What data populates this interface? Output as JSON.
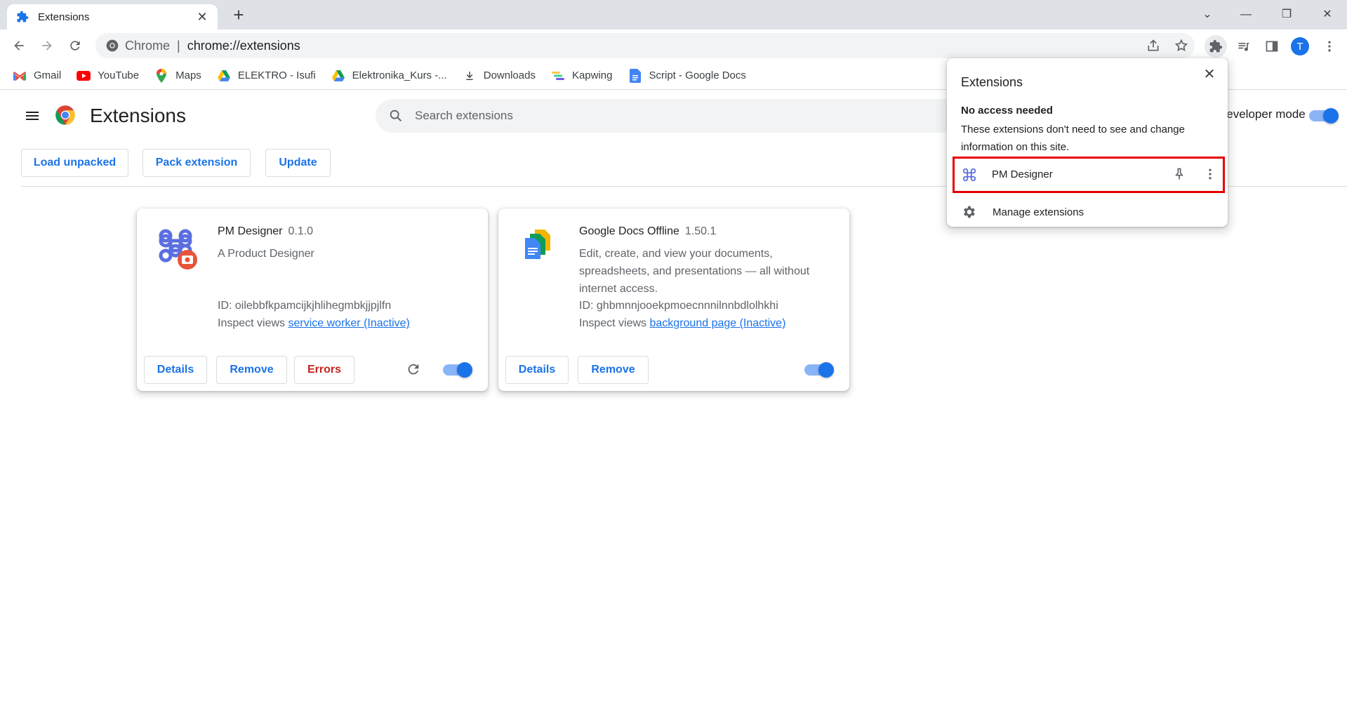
{
  "tab": {
    "title": "Extensions",
    "close": "✕",
    "new_tab": "+"
  },
  "window_controls": {
    "list": "⌄",
    "minimize": "—",
    "restore": "❐",
    "close": "✕"
  },
  "omnibox": {
    "scheme": "Chrome",
    "separator": "|",
    "url": "chrome://extensions"
  },
  "avatar_letter": "T",
  "bookmarks": [
    {
      "label": "Gmail",
      "icon": "gmail-icon"
    },
    {
      "label": "YouTube",
      "icon": "youtube-icon"
    },
    {
      "label": "Maps",
      "icon": "maps-icon"
    },
    {
      "label": "ELEKTRO - Isufi",
      "icon": "drive-icon"
    },
    {
      "label": "Elektronika_Kurs -...",
      "icon": "drive-icon"
    },
    {
      "label": "Downloads",
      "icon": "download-icon"
    },
    {
      "label": "Kapwing",
      "icon": "kapwing-icon"
    },
    {
      "label": "Script - Google Docs",
      "icon": "docs-icon"
    }
  ],
  "page": {
    "title": "Extensions",
    "search_placeholder": "Search extensions",
    "dev_mode_label": "Developer mode",
    "buttons": {
      "load_unpacked": "Load unpacked",
      "pack_extension": "Pack extension",
      "update": "Update"
    }
  },
  "cards": [
    {
      "name": "PM Designer",
      "version": "0.1.0",
      "description": "A Product Designer",
      "id": "ID: oilebbfkpamcijkjhlihegmbkjjpjlfn",
      "inspect_label": "Inspect views",
      "inspect_link": "service worker (Inactive)",
      "details": "Details",
      "remove": "Remove",
      "errors": "Errors",
      "enabled": true
    },
    {
      "name": "Google Docs Offline",
      "version": "1.50.1",
      "description": "Edit, create, and view your documents, spreadsheets, and presentations — all without internet access.",
      "id": "ID: ghbmnnjooekpmoecnnnilnnbdlolhkhi",
      "inspect_label": "Inspect views",
      "inspect_link": "background page (Inactive)",
      "details": "Details",
      "remove": "Remove",
      "enabled": true
    }
  ],
  "popup": {
    "title": "Extensions",
    "close": "✕",
    "section_title": "No access needed",
    "section_desc": "These extensions don't need to see and change information on this site.",
    "item_label": "PM Designer",
    "manage_label": "Manage extensions"
  },
  "colors": {
    "accent": "#1a73e8",
    "highlight_border": "#e50000",
    "error": "#c5221f"
  }
}
